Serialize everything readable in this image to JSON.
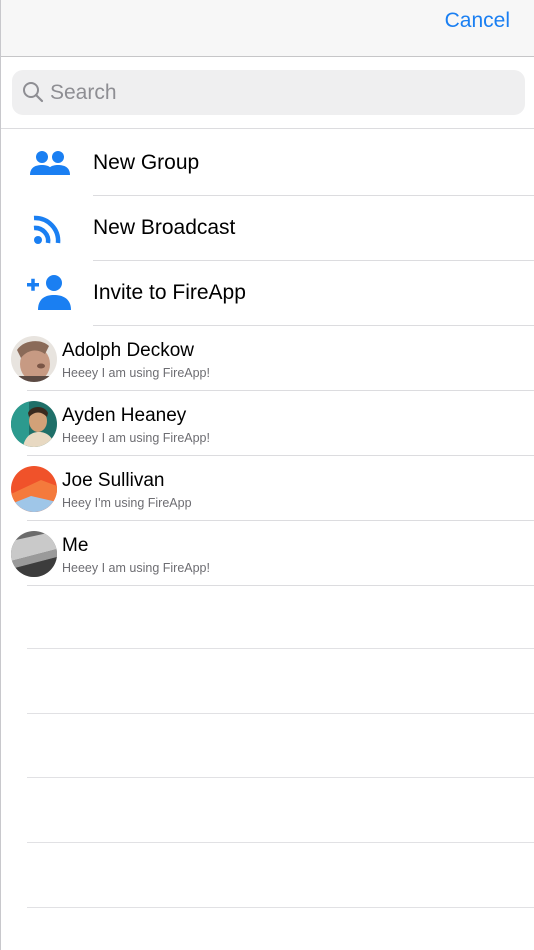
{
  "nav": {
    "cancel_label": "Cancel"
  },
  "search": {
    "placeholder": "Search",
    "value": ""
  },
  "actions": [
    {
      "label": "New Group",
      "icon": "group-icon"
    },
    {
      "label": "New Broadcast",
      "icon": "broadcast-icon"
    },
    {
      "label": "Invite to FireApp",
      "icon": "add-person-icon"
    }
  ],
  "contacts": [
    {
      "name": "Adolph Deckow",
      "status": "Heeey I am using FireApp!"
    },
    {
      "name": "Ayden Heaney",
      "status": "Heeey I am using FireApp!"
    },
    {
      "name": "Joe Sullivan",
      "status": "Heey I'm using FireApp"
    },
    {
      "name": "Me",
      "status": "Heeey I am using FireApp!"
    }
  ],
  "colors": {
    "accent": "#1a7ff2",
    "separator": "#dcdcdf",
    "nav_bg": "#f7f7f7"
  }
}
